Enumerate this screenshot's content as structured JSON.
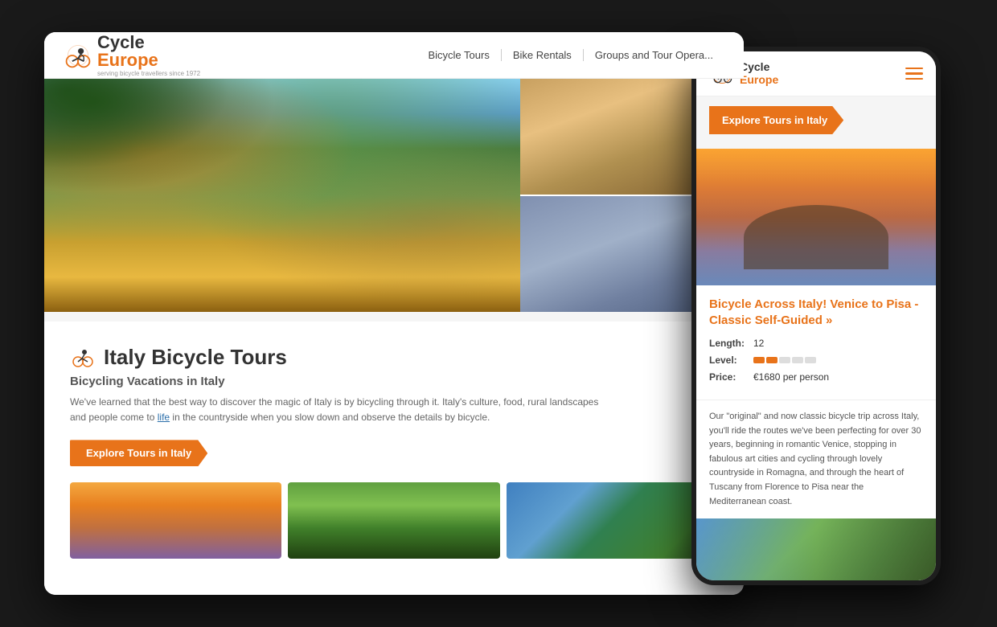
{
  "desktop": {
    "nav": {
      "logo_cycle": "Cycle",
      "logo_europe": "Europe",
      "tagline": "serving bicycle travellers since 1972",
      "links": [
        "Bicycle Tours",
        "Bike Rentals",
        "Groups and Tour Opera..."
      ]
    },
    "italy_section": {
      "title": "Italy Bicycle Tours",
      "subtitle": "Bicycling Vacations in Italy",
      "desc": "We've learned that the best way to discover the magic of Italy is by bicycling through it. Italy's culture, food, rural landscapes and people come to life in the countryside when you slow down and observe the details by bicycle.",
      "explore_btn": "Explore Tours in Italy"
    }
  },
  "mobile": {
    "nav": {
      "logo_cycle": "Cycle",
      "logo_europe": "Europe",
      "menu_icon": "hamburger-icon"
    },
    "explore_badge": "Explore Tours in Italy",
    "tour": {
      "title": "Bicycle Across Italy! Venice to Pisa - Classic Self-Guided »",
      "length_label": "Length:",
      "length_value": "12",
      "level_label": "Level:",
      "level_value": 2,
      "level_max": 5,
      "price_label": "Price:",
      "price_value": "€1680 per person",
      "desc": "Our \"original\" and now classic bicycle trip across Italy, you'll ride the routes we've been perfecting for over 30 years, beginning in romantic Venice, stopping in fabulous art cities and cycling through lovely countryside in Romagna, and through the heart of Tuscany from Florence to Pisa near the Mediterranean coast."
    }
  }
}
